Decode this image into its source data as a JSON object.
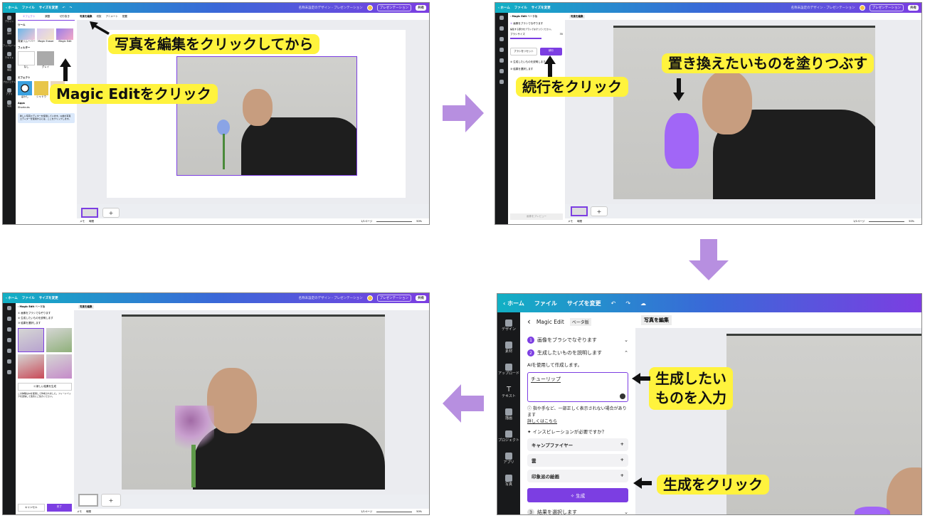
{
  "topbar": {
    "home": "ホーム",
    "file": "ファイル",
    "resize": "サイズを変更",
    "doc_title": "名称未設定のデザイン - プレゼンテーション",
    "present": "プレゼンテーション",
    "share": "共有"
  },
  "rail": [
    {
      "label": "デザイン"
    },
    {
      "label": "素材"
    },
    {
      "label": "アップロード"
    },
    {
      "label": "テキスト"
    },
    {
      "label": "描画"
    },
    {
      "label": "プロジェクト"
    },
    {
      "label": "アプリ"
    },
    {
      "label": "写真"
    }
  ],
  "editor_toolbar": {
    "edit_photo": "写真を編集",
    "crop": "切抜",
    "animate": "アニメート",
    "position": "配置"
  },
  "edit_panel": {
    "tab_effects": "エフェクト",
    "tab_adjust": "調整",
    "tab_crop": "切り抜き",
    "tools_title": "ツール",
    "tools": [
      "背景リムーバー",
      "Magic Eraser",
      "Magic Edit"
    ],
    "filters_title": "フィルター",
    "filters": [
      "なし",
      "グレイ"
    ],
    "effects_title": "エフェクト",
    "effects": [
      "ぼかし",
      "シャドウ",
      "曲げ"
    ],
    "apps_title": "Apps",
    "app": "Shortcuts",
    "notice": "新しい写真エディターを使用しています。以前の写真エディターを使用するには、ここをクリックします。"
  },
  "magic_edit": {
    "back": "‹",
    "title": "Magic Edit",
    "beta": "ベータ版",
    "step1": "画像をブラシでなぞります",
    "step1_desc": "編集する部分をブラシでなぞってください。",
    "brush_size": "ブラシサイズ",
    "brush_value": "35",
    "reset": "ブラシをリセット",
    "continue": "続行",
    "step2": "生成したいものを説明します",
    "step2_desc": "AIを使用して作成します。",
    "prompt_value": "チューリップ",
    "disclaimer": "指や手など、一部正しく表示されない場合があります",
    "learn_more": "詳しくはこちら",
    "inspiration": "インスピレーションが必要ですか？",
    "suggestions": [
      "キャンプファイヤー",
      "雲",
      "印象派の絵画"
    ],
    "generate": "生成",
    "step3": "結果を選択します",
    "generate_new": "新しい結果を生成",
    "result_desc": "この体験はAIを使用して作成されました。フィードバックを送信して改善にご協力ください。",
    "cancel": "キャンセル",
    "done": "完了",
    "apply_disabled": "画像をプレビュー"
  },
  "bottom": {
    "notes": "メモ",
    "timer": "時間",
    "page": "1/1ページ",
    "zoom": "50%"
  },
  "callouts": {
    "c1": "写真を編集をクリックしてから",
    "c2": "Magic Editをクリック",
    "c3": "置き換えたいものを塗りつぶす",
    "c4": "続行をクリック",
    "c5": "生成したい\nものを入力",
    "c6": "生成をクリック"
  },
  "colors": {
    "accent": "#7c3ee2",
    "callout": "#fff33d",
    "arrow": "#b78fe0",
    "rail": "#18191b"
  }
}
